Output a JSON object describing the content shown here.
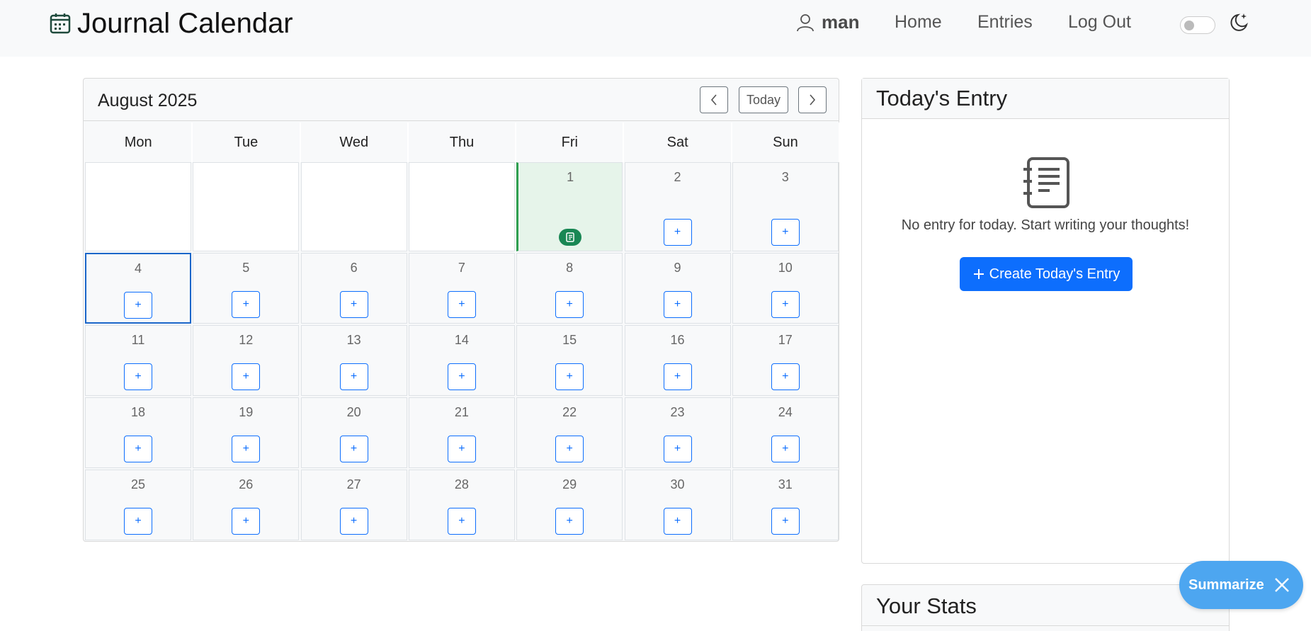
{
  "navbar": {
    "brand": "Journal Calendar",
    "username": "man",
    "links": [
      "Home",
      "Entries",
      "Log Out"
    ]
  },
  "calendar": {
    "month_label": "August 2025",
    "today_button": "Today",
    "weekdays": [
      "Mon",
      "Tue",
      "Wed",
      "Thu",
      "Fri",
      "Sat",
      "Sun"
    ],
    "add_label": "+",
    "days": [
      "1",
      "2",
      "3",
      "4",
      "5",
      "6",
      "7",
      "8",
      "9",
      "10",
      "11",
      "12",
      "13",
      "14",
      "15",
      "16",
      "17",
      "18",
      "19",
      "20",
      "21",
      "22",
      "23",
      "24",
      "25",
      "26",
      "27",
      "28",
      "29",
      "30",
      "31"
    ]
  },
  "today_entry": {
    "title": "Today's Entry",
    "empty_message": "No entry for today. Start writing your thoughts!",
    "create_button": "Create Today's Entry"
  },
  "stats": {
    "title": "Your Stats"
  },
  "summarize": {
    "label": "Summarize"
  },
  "colors": {
    "primary": "#0d6efd",
    "entry_badge": "#198754",
    "entry_cell_bg": "#e6f4ea",
    "summarize_bg": "#4da6f0"
  }
}
